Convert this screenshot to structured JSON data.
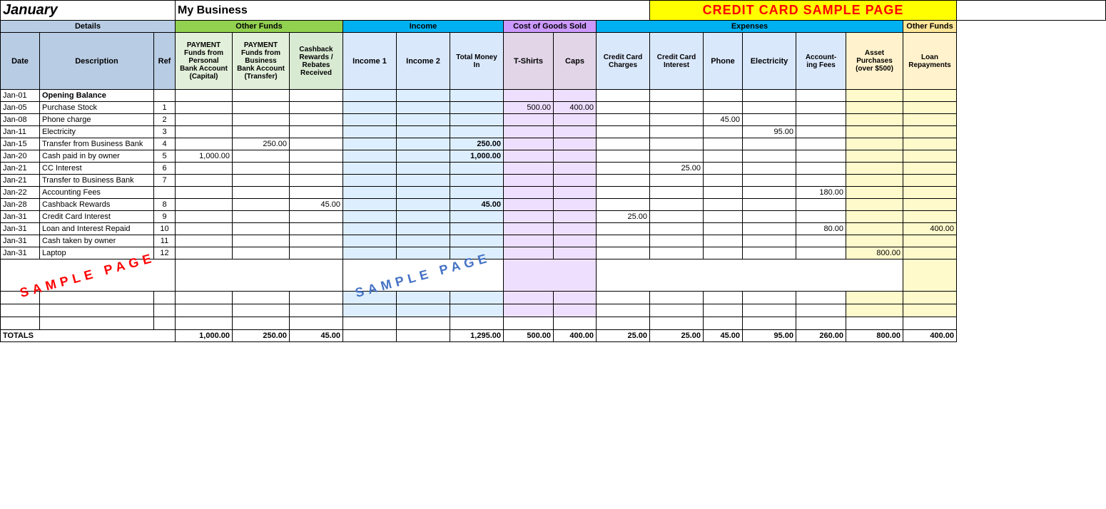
{
  "title": {
    "month": "January",
    "business": "My Business",
    "credit_card_page": "CREDIT CARD SAMPLE PAGE"
  },
  "headers": {
    "details": "Details",
    "other_funds": "Other Funds",
    "income": "Income",
    "cost_of_goods": "Cost of Goods Sold",
    "expenses": "Expenses",
    "other_funds2": "Other Funds"
  },
  "col_headers": {
    "date": "Date",
    "description": "Description",
    "ref": "Ref",
    "payment_personal": "PAYMENT Funds from Personal Bank Account (Capital)",
    "payment_business": "PAYMENT Funds from Business Bank Account (Transfer)",
    "cashback": "Cashback Rewards / Rebates Received",
    "income1": "Income 1",
    "income2": "Income 2",
    "total_money_in": "Total Money In",
    "tshirts": "T-Shirts",
    "caps": "Caps",
    "cc_charges": "Credit Card Charges",
    "cc_interest": "Credit Card Interest",
    "phone": "Phone",
    "electricity": "Electricity",
    "accounting_fees": "Account-ing Fees",
    "asset_purchases": "Asset Purchases (over $500)",
    "loan_repayments": "Loan Repayments"
  },
  "rows": [
    {
      "date": "Jan-01",
      "desc": "Opening Balance",
      "ref": "",
      "pay_personal": "",
      "pay_business": "",
      "cashback": "",
      "income1": "",
      "income2": "",
      "total_money": "",
      "tshirts": "",
      "caps": "",
      "cc_charges": "",
      "cc_interest": "",
      "phone": "",
      "electricity": "",
      "acct_fees": "",
      "asset_purch": "",
      "loan_repay": "",
      "opening": true
    },
    {
      "date": "Jan-05",
      "desc": "Purchase Stock",
      "ref": "1",
      "pay_personal": "",
      "pay_business": "",
      "cashback": "",
      "income1": "",
      "income2": "",
      "total_money": "",
      "tshirts": "500.00",
      "caps": "400.00",
      "cc_charges": "",
      "cc_interest": "",
      "phone": "",
      "electricity": "",
      "acct_fees": "",
      "asset_purch": "",
      "loan_repay": ""
    },
    {
      "date": "Jan-08",
      "desc": "Phone charge",
      "ref": "2",
      "pay_personal": "",
      "pay_business": "",
      "cashback": "",
      "income1": "",
      "income2": "",
      "total_money": "",
      "tshirts": "",
      "caps": "",
      "cc_charges": "",
      "cc_interest": "",
      "phone": "45.00",
      "electricity": "",
      "acct_fees": "",
      "asset_purch": "",
      "loan_repay": ""
    },
    {
      "date": "Jan-11",
      "desc": "Electricity",
      "ref": "3",
      "pay_personal": "",
      "pay_business": "",
      "cashback": "",
      "income1": "",
      "income2": "",
      "total_money": "",
      "tshirts": "",
      "caps": "",
      "cc_charges": "",
      "cc_interest": "",
      "phone": "",
      "electricity": "95.00",
      "acct_fees": "",
      "asset_purch": "",
      "loan_repay": ""
    },
    {
      "date": "Jan-15",
      "desc": "Transfer from Business Bank",
      "ref": "4",
      "pay_personal": "",
      "pay_business": "250.00",
      "cashback": "",
      "income1": "",
      "income2": "",
      "total_money": "250.00",
      "tshirts": "",
      "caps": "",
      "cc_charges": "",
      "cc_interest": "",
      "phone": "",
      "electricity": "",
      "acct_fees": "",
      "asset_purch": "",
      "loan_repay": ""
    },
    {
      "date": "Jan-20",
      "desc": "Cash paid in by owner",
      "ref": "5",
      "pay_personal": "1,000.00",
      "pay_business": "",
      "cashback": "",
      "income1": "",
      "income2": "",
      "total_money": "1,000.00",
      "tshirts": "",
      "caps": "",
      "cc_charges": "",
      "cc_interest": "",
      "phone": "",
      "electricity": "",
      "acct_fees": "",
      "asset_purch": "",
      "loan_repay": ""
    },
    {
      "date": "Jan-21",
      "desc": "CC Interest",
      "ref": "6",
      "pay_personal": "",
      "pay_business": "",
      "cashback": "",
      "income1": "",
      "income2": "",
      "total_money": "",
      "tshirts": "",
      "caps": "",
      "cc_charges": "",
      "cc_interest": "25.00",
      "phone": "",
      "electricity": "",
      "acct_fees": "",
      "asset_purch": "",
      "loan_repay": ""
    },
    {
      "date": "Jan-21",
      "desc": "Transfer to Business Bank",
      "ref": "7",
      "pay_personal": "",
      "pay_business": "",
      "cashback": "",
      "income1": "",
      "income2": "",
      "total_money": "",
      "tshirts": "",
      "caps": "",
      "cc_charges": "",
      "cc_interest": "",
      "phone": "",
      "electricity": "",
      "acct_fees": "",
      "asset_purch": "",
      "loan_repay": ""
    },
    {
      "date": "Jan-22",
      "desc": "Accounting Fees",
      "ref": "",
      "pay_personal": "",
      "pay_business": "",
      "cashback": "",
      "income1": "",
      "income2": "",
      "total_money": "",
      "tshirts": "",
      "caps": "",
      "cc_charges": "",
      "cc_interest": "",
      "phone": "",
      "electricity": "",
      "acct_fees": "180.00",
      "asset_purch": "",
      "loan_repay": ""
    },
    {
      "date": "Jan-28",
      "desc": "Cashback Rewards",
      "ref": "8",
      "pay_personal": "",
      "pay_business": "",
      "cashback": "45.00",
      "income1": "",
      "income2": "",
      "total_money": "45.00",
      "tshirts": "",
      "caps": "",
      "cc_charges": "",
      "cc_interest": "",
      "phone": "",
      "electricity": "",
      "acct_fees": "",
      "asset_purch": "",
      "loan_repay": ""
    },
    {
      "date": "Jan-31",
      "desc": "Credit Card Interest",
      "ref": "9",
      "pay_personal": "",
      "pay_business": "",
      "cashback": "",
      "income1": "",
      "income2": "",
      "total_money": "",
      "tshirts": "",
      "caps": "",
      "cc_charges": "25.00",
      "cc_interest": "",
      "phone": "",
      "electricity": "",
      "acct_fees": "",
      "asset_purch": "",
      "loan_repay": ""
    },
    {
      "date": "Jan-31",
      "desc": "Loan and Interest Repaid",
      "ref": "10",
      "pay_personal": "",
      "pay_business": "",
      "cashback": "",
      "income1": "",
      "income2": "",
      "total_money": "",
      "tshirts": "",
      "caps": "",
      "cc_charges": "",
      "cc_interest": "",
      "phone": "",
      "electricity": "",
      "acct_fees": "80.00",
      "asset_purch": "",
      "loan_repay": "400.00"
    },
    {
      "date": "Jan-31",
      "desc": "Cash taken by owner",
      "ref": "11",
      "pay_personal": "",
      "pay_business": "",
      "cashback": "",
      "income1": "",
      "income2": "",
      "total_money": "",
      "tshirts": "",
      "caps": "",
      "cc_charges": "",
      "cc_interest": "",
      "phone": "",
      "electricity": "",
      "acct_fees": "",
      "asset_purch": "",
      "loan_repay": ""
    },
    {
      "date": "Jan-31",
      "desc": "Laptop",
      "ref": "12",
      "pay_personal": "",
      "pay_business": "",
      "cashback": "",
      "income1": "",
      "income2": "",
      "total_money": "",
      "tshirts": "",
      "caps": "",
      "cc_charges": "",
      "cc_interest": "",
      "phone": "",
      "electricity": "",
      "acct_fees": "",
      "asset_purch": "800.00",
      "loan_repay": ""
    }
  ],
  "totals": {
    "label": "TOTALS",
    "pay_personal": "1,000.00",
    "pay_business": "250.00",
    "cashback": "45.00",
    "income1": "",
    "income2": "",
    "total_money": "1,295.00",
    "tshirts": "500.00",
    "caps": "400.00",
    "cc_charges": "25.00",
    "cc_interest": "25.00",
    "phone": "45.00",
    "electricity": "95.00",
    "acct_fees": "260.00",
    "asset_purch": "800.00",
    "loan_repay": "400.00"
  },
  "sample_page": "SAMPLE PAGE"
}
